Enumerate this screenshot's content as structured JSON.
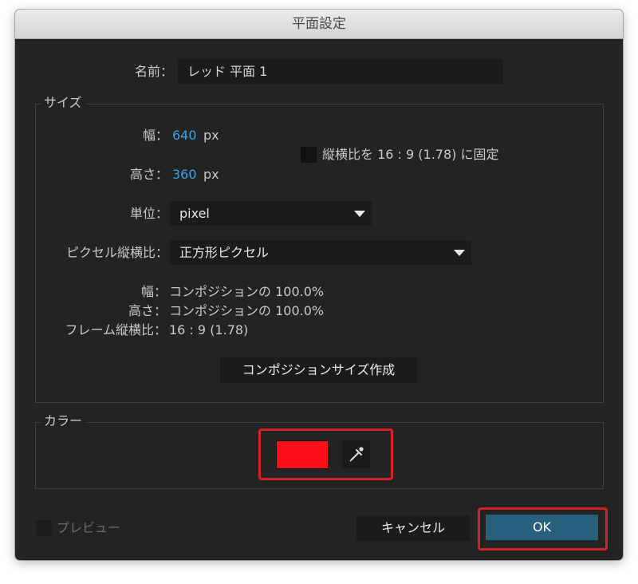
{
  "window": {
    "title": "平面設定"
  },
  "name": {
    "label": "名前：",
    "value": "レッド 平面 1"
  },
  "size": {
    "group_label": "サイズ",
    "width_label": "幅：",
    "width_value": "640",
    "width_unit": "px",
    "height_label": "高さ：",
    "height_value": "360",
    "height_unit": "px",
    "lock_label": "縦横比を 16 : 9 (1.78) に固定",
    "lock_checked": false,
    "units_label": "単位：",
    "units_value": "pixel",
    "pixel_aspect_label": "ピクセル縦横比：",
    "pixel_aspect_value": "正方形ピクセル",
    "info_width_label": "幅：",
    "info_width_value": "コンポジションの 100.0%",
    "info_height_label": "高さ：",
    "info_height_value": "コンポジションの 100.0%",
    "info_frame_label": "フレーム縦横比：",
    "info_frame_value": "16 : 9 (1.78)",
    "make_comp_size_label": "コンポジションサイズ作成"
  },
  "color": {
    "group_label": "カラー",
    "swatch_color": "#ff0d17",
    "eyedropper_icon": "eyedropper-icon",
    "highlight_color": "#d42027"
  },
  "footer": {
    "preview_label": "プレビュー",
    "preview_checked": false,
    "cancel_label": "キャンセル",
    "ok_label": "OK"
  }
}
